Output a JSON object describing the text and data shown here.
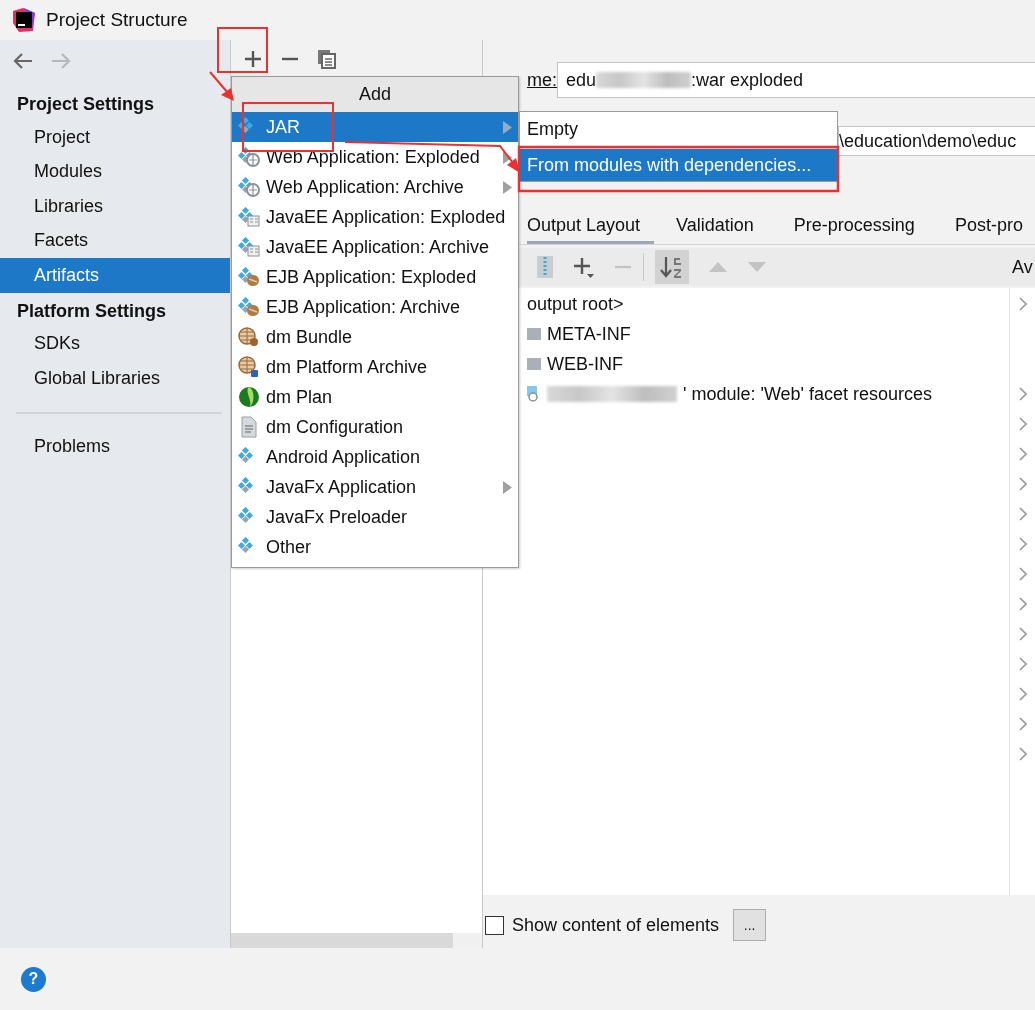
{
  "window": {
    "title": "Project Structure"
  },
  "nav": {
    "back_disabled": false,
    "forward_disabled": true
  },
  "sidebar": {
    "sections": [
      {
        "title": "Project Settings",
        "items": [
          {
            "label": "Project",
            "selected": false
          },
          {
            "label": "Modules",
            "selected": false
          },
          {
            "label": "Libraries",
            "selected": false
          },
          {
            "label": "Facets",
            "selected": false
          },
          {
            "label": "Artifacts",
            "selected": true
          }
        ]
      },
      {
        "title": "Platform Settings",
        "items": [
          {
            "label": "SDKs",
            "selected": false
          },
          {
            "label": "Global Libraries",
            "selected": false
          }
        ]
      }
    ],
    "footer_items": [
      {
        "label": "Problems",
        "selected": false
      }
    ]
  },
  "artifact_toolbar": [
    {
      "kind": "add"
    },
    {
      "kind": "remove"
    },
    {
      "kind": "copy"
    }
  ],
  "add_menu": {
    "title": "Add",
    "items": [
      {
        "label": "JAR",
        "kind": "jar",
        "selected": true,
        "has_submenu": true
      },
      {
        "label": "Web Application: Exploded",
        "kind": "web",
        "selected": false,
        "has_submenu": true
      },
      {
        "label": "Web Application: Archive",
        "kind": "web",
        "selected": false,
        "has_submenu": true
      },
      {
        "label": "JavaEE Application: Exploded",
        "kind": "javaee",
        "selected": false,
        "has_submenu": false
      },
      {
        "label": "JavaEE Application: Archive",
        "kind": "javaee",
        "selected": false,
        "has_submenu": false
      },
      {
        "label": "EJB Application: Exploded",
        "kind": "ejb",
        "selected": false,
        "has_submenu": false
      },
      {
        "label": "EJB Application: Archive",
        "kind": "ejb",
        "selected": false,
        "has_submenu": false
      },
      {
        "label": "dm Bundle",
        "kind": "bundle",
        "selected": false,
        "has_submenu": false
      },
      {
        "label": "dm Platform Archive",
        "kind": "platform",
        "selected": false,
        "has_submenu": false
      },
      {
        "label": "dm Plan",
        "kind": "plan",
        "selected": false,
        "has_submenu": false
      },
      {
        "label": "dm Configuration",
        "kind": "config",
        "selected": false,
        "has_submenu": false
      },
      {
        "label": "Android Application",
        "kind": "jar",
        "selected": false,
        "has_submenu": false
      },
      {
        "label": "JavaFx Application",
        "kind": "jar",
        "selected": false,
        "has_submenu": true
      },
      {
        "label": "JavaFx Preloader",
        "kind": "jar",
        "selected": false,
        "has_submenu": false
      },
      {
        "label": "Other",
        "kind": "jar",
        "selected": false,
        "has_submenu": false
      }
    ]
  },
  "jar_submenu": {
    "items": [
      {
        "label": "Empty",
        "selected": false
      },
      {
        "label": "From modules with dependencies...",
        "selected": true
      }
    ]
  },
  "artifact": {
    "name_label": "me:",
    "name_value_start": "edu",
    "name_value_end": ":war exploded",
    "output_directory_value": "\\education\\demo\\educ",
    "tabs": [
      {
        "label": "Output Layout",
        "selected": true
      },
      {
        "label": "Validation",
        "selected": false
      },
      {
        "label": "Pre-processing",
        "selected": false
      },
      {
        "label": "Post-pro",
        "selected": false
      }
    ],
    "toolbar": [
      {
        "kind": "archive"
      },
      {
        "kind": "add",
        "disabled": false
      },
      {
        "kind": "remove",
        "disabled": true
      },
      {
        "kind": "sort",
        "selected": true
      },
      {
        "kind": "up",
        "disabled": true
      },
      {
        "kind": "down",
        "disabled": true
      }
    ],
    "available_label": "Av",
    "tree": [
      {
        "label": "output root>",
        "kind": "root",
        "children": [
          {
            "label": "META-INF",
            "kind": "folder"
          },
          {
            "label": "WEB-INF",
            "kind": "folder"
          },
          {
            "label": "' module: 'Web' facet resources",
            "kind": "facet"
          }
        ]
      }
    ],
    "available_rows": [
      {
        "expandable": true
      },
      {
        "expandable": false
      },
      {
        "expandable": false
      },
      {
        "expandable": true
      },
      {
        "expandable": true
      },
      {
        "expandable": true
      },
      {
        "expandable": true
      },
      {
        "expandable": true
      },
      {
        "expandable": true
      },
      {
        "expandable": true
      },
      {
        "expandable": true
      },
      {
        "expandable": true
      },
      {
        "expandable": true
      },
      {
        "expandable": true
      },
      {
        "expandable": true
      },
      {
        "expandable": true
      }
    ],
    "show_content": {
      "label": "Show content of elements",
      "checked": false
    },
    "more_button": "..."
  },
  "help_button": "?"
}
